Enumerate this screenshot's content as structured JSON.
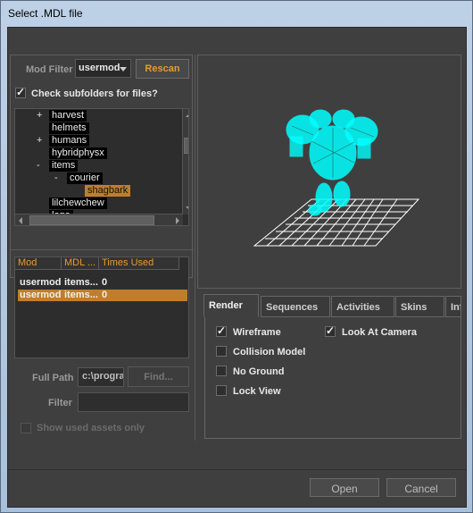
{
  "window": {
    "title": "Select .MDL file"
  },
  "left": {
    "mod_filter_label": "Mod Filter",
    "mod_filter_value": "usermod",
    "rescan_label": "Rescan",
    "subfolders_label": "Check subfolders for files?",
    "subfolders_checked": true,
    "tree": [
      {
        "expander": "+",
        "label": "harvest"
      },
      {
        "expander": "",
        "label": "helmets"
      },
      {
        "expander": "+",
        "label": "humans"
      },
      {
        "expander": "",
        "label": "hybridphysx"
      },
      {
        "expander": "-",
        "label": "items"
      },
      {
        "expander": "-",
        "label": "courier"
      },
      {
        "expander": "",
        "label": "shagbark",
        "selected": true
      },
      {
        "expander": "",
        "label": "lilchewchew"
      },
      {
        "expander": "",
        "label": "logo"
      },
      {
        "expander": "",
        "label": "..."
      }
    ],
    "list_headers": [
      "Mod",
      "MDL ...",
      "Times Used"
    ],
    "list_rows": [
      {
        "mod": "usermod",
        "mdl": "items...",
        "times": "0",
        "selected": false
      },
      {
        "mod": "usermod",
        "mdl": "items...",
        "times": "0",
        "selected": true
      }
    ],
    "full_path_label": "Full Path",
    "full_path_value": "c:\\progra",
    "find_label": "Find...",
    "filter_label": "Filter",
    "filter_value": "",
    "show_used_label": "Show used assets only"
  },
  "tabs": [
    "Render",
    "Sequences",
    "Activities",
    "Skins",
    "Inf"
  ],
  "render_options": {
    "wireframe": {
      "label": "Wireframe",
      "checked": true
    },
    "look_at_camera": {
      "label": "Look At Camera",
      "checked": true
    },
    "collision_model": {
      "label": "Collision Model",
      "checked": false
    },
    "no_ground": {
      "label": "No Ground",
      "checked": false
    },
    "lock_view": {
      "label": "Lock View",
      "checked": false
    }
  },
  "footer": {
    "open_label": "Open",
    "cancel_label": "Cancel"
  },
  "colors": {
    "accent": "#e89a2c",
    "selection": "#c07e2a",
    "wireframe_model": "#00ffff",
    "grid": "#ffffff",
    "panel": "#3f3f3f"
  }
}
